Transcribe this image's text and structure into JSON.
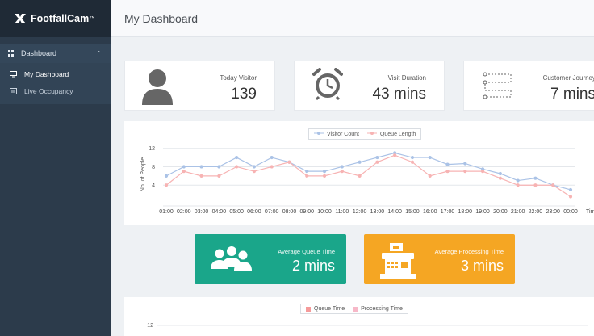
{
  "brand": {
    "name": "FootfallCam",
    "tm": "™"
  },
  "sidebar": {
    "section_label": "Dashboard",
    "items": [
      {
        "label": "My Dashboard"
      },
      {
        "label": "Live Occupancy"
      }
    ]
  },
  "header": {
    "title": "My Dashboard"
  },
  "stats": [
    {
      "label": "Today Visitor",
      "value": "139"
    },
    {
      "label": "Visit Duration",
      "value": "43 mins"
    },
    {
      "label": "Customer Journey",
      "value": "7 mins"
    }
  ],
  "tiles": [
    {
      "label": "Average Queue Time",
      "value": "2 mins",
      "color": "#1aa68a"
    },
    {
      "label": "Average Processing Time",
      "value": "3 mins",
      "color": "#f5a623"
    }
  ],
  "colors": {
    "visitor_series": "#aac2e6",
    "queue_series": "#f7b3b3",
    "queue_time": "#f59a9a",
    "processing_time": "#f7b8c8"
  },
  "chart_data": [
    {
      "type": "line",
      "ylabel": "No. of People",
      "xlabel": "Tim",
      "yticks": [
        "4",
        "8",
        "12"
      ],
      "ylim": [
        0,
        13
      ],
      "grid": true,
      "legend_position": "top",
      "categories": [
        "01:00",
        "02:00",
        "03:00",
        "04:00",
        "05:00",
        "06:00",
        "07:00",
        "08:00",
        "09:00",
        "10:00",
        "11:00",
        "12:00",
        "13:00",
        "14:00",
        "15:00",
        "16:00",
        "17:00",
        "18:00",
        "19:00",
        "20:00",
        "21:00",
        "22:00",
        "23:00",
        "00:00"
      ],
      "series": [
        {
          "name": "Visitor Count",
          "values": [
            6,
            8,
            8,
            8,
            10,
            8,
            10,
            9,
            7,
            7,
            8,
            9,
            10,
            11,
            10,
            10,
            8.5,
            8.7,
            7.5,
            6.5,
            5,
            5.5,
            4,
            3
          ]
        },
        {
          "name": "Queue Length",
          "values": [
            4,
            7,
            6,
            6,
            8,
            7,
            8,
            9,
            6,
            6,
            7,
            6,
            9,
            10.5,
            9,
            6,
            7,
            7,
            7,
            5.5,
            4,
            4,
            4,
            1.5
          ]
        }
      ]
    },
    {
      "type": "bar",
      "yticks": [
        "12"
      ],
      "legend_position": "top",
      "series": [
        {
          "name": "Queue Time"
        },
        {
          "name": "Processing Time"
        }
      ]
    }
  ]
}
